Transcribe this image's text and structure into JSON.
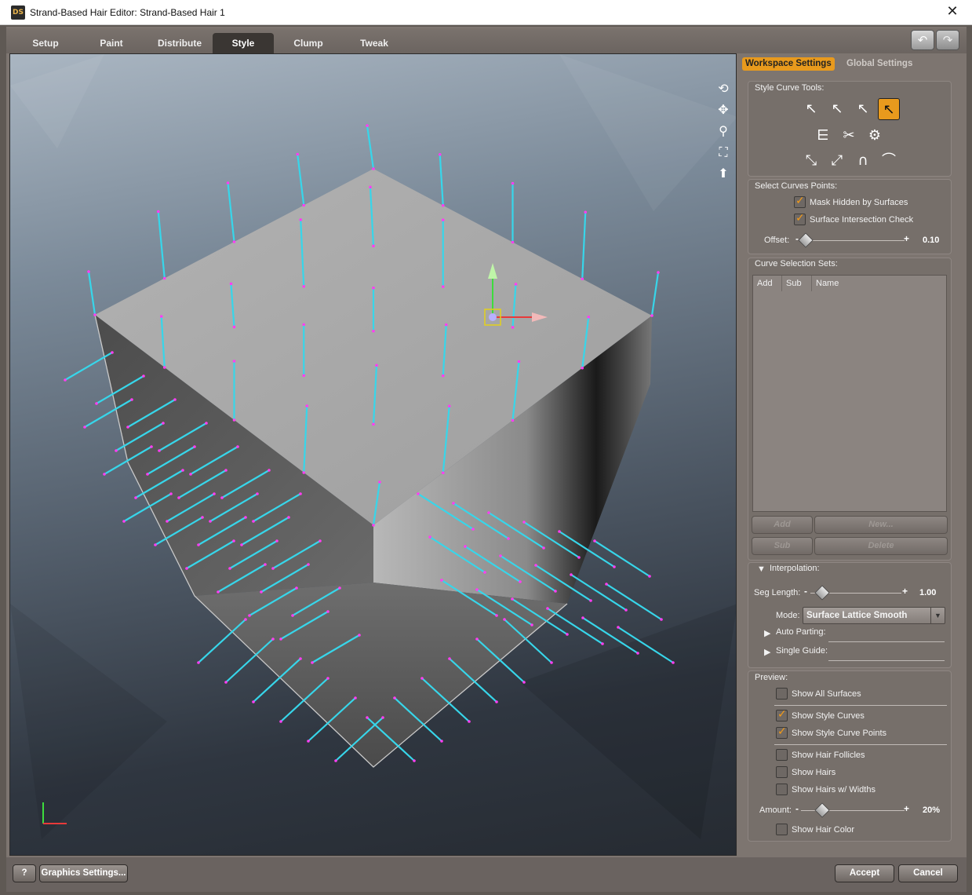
{
  "window": {
    "title": "Strand-Based Hair Editor: Strand-Based Hair 1",
    "app_icon": "DS",
    "close_glyph": "✕"
  },
  "tabs": [
    {
      "label": "Setup"
    },
    {
      "label": "Paint"
    },
    {
      "label": "Distribute"
    },
    {
      "label": "Style"
    },
    {
      "label": "Clump"
    },
    {
      "label": "Tweak"
    }
  ],
  "toolbar": {
    "undo_icon": "↶",
    "redo_icon": "↷"
  },
  "viewport_tools": [
    "orbit-icon",
    "pan-icon",
    "zoom-icon",
    "frame-icon",
    "reset-view-icon"
  ],
  "panel": {
    "tabs": {
      "workspace": "Workspace Settings",
      "global": "Global Settings"
    },
    "style_curve_tools": {
      "label": "Style Curve Tools:",
      "rows": [
        [
          "select-cursor-icon",
          "select-add-cursor-icon",
          "select-remove-cursor-icon",
          "select-points-icon"
        ],
        [
          "comb-icon",
          "cut-icon",
          "rotate-settings-icon"
        ],
        [
          "tip-move-icon",
          "straighten-icon",
          "curl-icon",
          "bend-icon"
        ]
      ]
    },
    "select_points": {
      "label": "Select Curves Points:",
      "mask_hidden": "Mask Hidden by Surfaces",
      "intersection": "Surface Intersection Check",
      "offset_label": "Offset:",
      "offset_value": "0.10"
    },
    "selection_sets": {
      "label": "Curve Selection Sets:",
      "columns": [
        "Add",
        "Sub",
        "Name"
      ],
      "buttons": {
        "add": "Add",
        "new": "New...",
        "sub": "Sub",
        "delete": "Delete"
      }
    },
    "interpolation": {
      "label": "Interpolation:",
      "seg_length_label": "Seg Length:",
      "seg_length_value": "1.00",
      "mode_label": "Mode:",
      "mode_value": "Surface Lattice Smooth",
      "auto_parting": "Auto Parting:",
      "single_guide": "Single Guide:"
    },
    "preview": {
      "label": "Preview:",
      "show_all_surfaces": "Show All Surfaces",
      "show_style_curves": "Show Style Curves",
      "show_style_curve_points": "Show Style Curve Points",
      "show_hair_follicles": "Show Hair Follicles",
      "show_hairs": "Show Hairs",
      "show_hairs_widths": "Show Hairs w/ Widths",
      "amount_label": "Amount:",
      "amount_value": "20%",
      "show_hair_color": "Show Hair Color"
    },
    "slider_signs": {
      "minus": "-",
      "plus": "+"
    }
  },
  "bottom": {
    "help": "?",
    "graphics": "Graphics Settings...",
    "accept": "Accept",
    "cancel": "Cancel"
  },
  "colors": {
    "accent": "#e89a1d",
    "curve": "#37d6ea",
    "curve_point": "#ff3df2"
  }
}
